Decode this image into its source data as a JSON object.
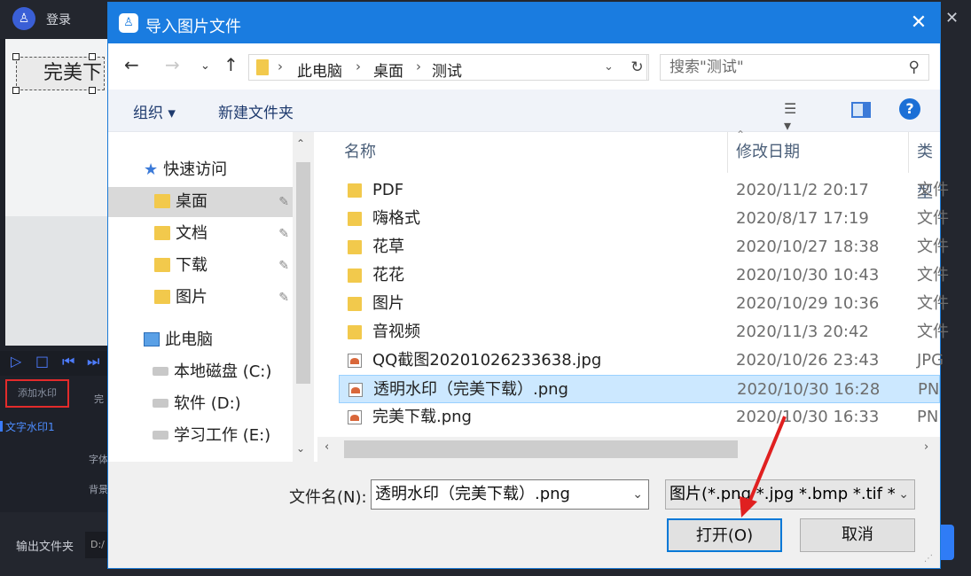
{
  "background_app": {
    "login_label": "登录",
    "watermark_text": "完美下",
    "add_watermark_label": "添加水印",
    "text_watermark_label": "文字水印1",
    "preview_snippet": "完",
    "font_label": "字体",
    "bg_label": "背景",
    "output_folder_label": "输出文件夹",
    "output_path": "D:/"
  },
  "dialog": {
    "title": "导入图片文件",
    "breadcrumbs": [
      "此电脑",
      "桌面",
      "测试"
    ],
    "search_placeholder": "搜索\"测试\"",
    "toolbar": {
      "organize": "组织 ▾",
      "new_folder": "新建文件夹"
    },
    "nav": {
      "quick_access": "快速访问",
      "desktop": "桌面",
      "documents": "文档",
      "downloads": "下载",
      "pictures": "图片",
      "this_pc": "此电脑",
      "disk_c": "本地磁盘 (C:)",
      "disk_d": "软件 (D:)",
      "disk_e": "学习工作 (E:)"
    },
    "columns": {
      "name": "名称",
      "date": "修改日期",
      "type": "类型"
    },
    "files": [
      {
        "name": "PDF",
        "date": "2020/11/2 20:17",
        "type": "文件",
        "kind": "folder"
      },
      {
        "name": "嗨格式",
        "date": "2020/8/17 17:19",
        "type": "文件",
        "kind": "folder"
      },
      {
        "name": "花草",
        "date": "2020/10/27 18:38",
        "type": "文件",
        "kind": "folder"
      },
      {
        "name": "花花",
        "date": "2020/10/30 10:43",
        "type": "文件",
        "kind": "folder"
      },
      {
        "name": "图片",
        "date": "2020/10/29 10:36",
        "type": "文件",
        "kind": "folder"
      },
      {
        "name": "音视频",
        "date": "2020/11/3 20:42",
        "type": "文件",
        "kind": "folder"
      },
      {
        "name": "QQ截图20201026233638.jpg",
        "date": "2020/10/26 23:43",
        "type": "JPG",
        "kind": "image"
      },
      {
        "name": "透明水印（完美下载）.png",
        "date": "2020/10/30 16:28",
        "type": "PN",
        "kind": "image",
        "selected": true
      },
      {
        "name": "完美下载.png",
        "date": "2020/10/30 16:33",
        "type": "PN",
        "kind": "image"
      }
    ],
    "filename_label": "文件名(N):",
    "filename_value": "透明水印（完美下载）.png",
    "filter_value": "图片(*.png *.jpg *.bmp *.tif *.t",
    "open_button": "打开(O)",
    "cancel_button": "取消"
  },
  "annotation_color": "#e02020"
}
